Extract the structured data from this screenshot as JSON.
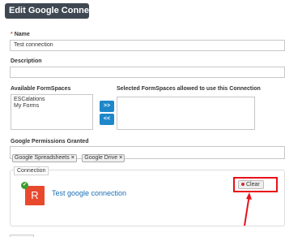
{
  "dialog": {
    "title": "Edit Google Connection"
  },
  "form": {
    "name_required_mark": "*",
    "name_label": "Name",
    "name_value": "Test connection",
    "description_label": "Description",
    "description_value": "",
    "available_label": "Available FormSpaces",
    "available_items": [
      "ESCalations",
      "My Forms"
    ],
    "selected_label": "Selected FormSpaces allowed to use this Connection",
    "add_button": ">>",
    "remove_button": "<<",
    "permissions_label": "Google Permissions Granted",
    "permissions": [
      {
        "label": "Google Spreadsheets",
        "remove": "×"
      },
      {
        "label": "Google Drive",
        "remove": "×"
      }
    ]
  },
  "connection": {
    "legend": "Connection",
    "avatar_letter": "R",
    "check_icon": "✔",
    "name": "Test google connection",
    "clear_label": "Clear"
  },
  "annotation": {
    "highlight_color": "#e8101a"
  }
}
